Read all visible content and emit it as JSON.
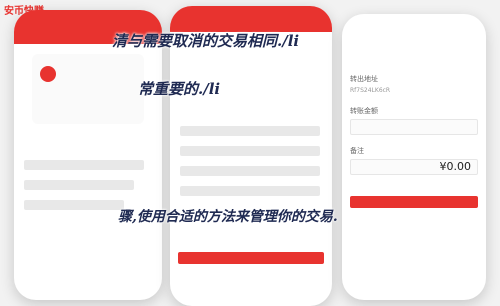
{
  "app": {
    "title": "安币快赚"
  },
  "phone_right": {
    "to_label": "转出地址",
    "to_value": "Rf7S24LK6cR",
    "amount_label": "转账金额",
    "amount_value": "",
    "note_label": "备注",
    "fee_value": "¥0.00"
  },
  "overlay": {
    "line1": "清与需要取消的交易相同./li",
    "line2": "常重要的./li",
    "line3": "骤,使用合适的方法来管理你的交易."
  },
  "colors": {
    "accent": "#e8332f",
    "overlay_text": "#1f2a52"
  }
}
